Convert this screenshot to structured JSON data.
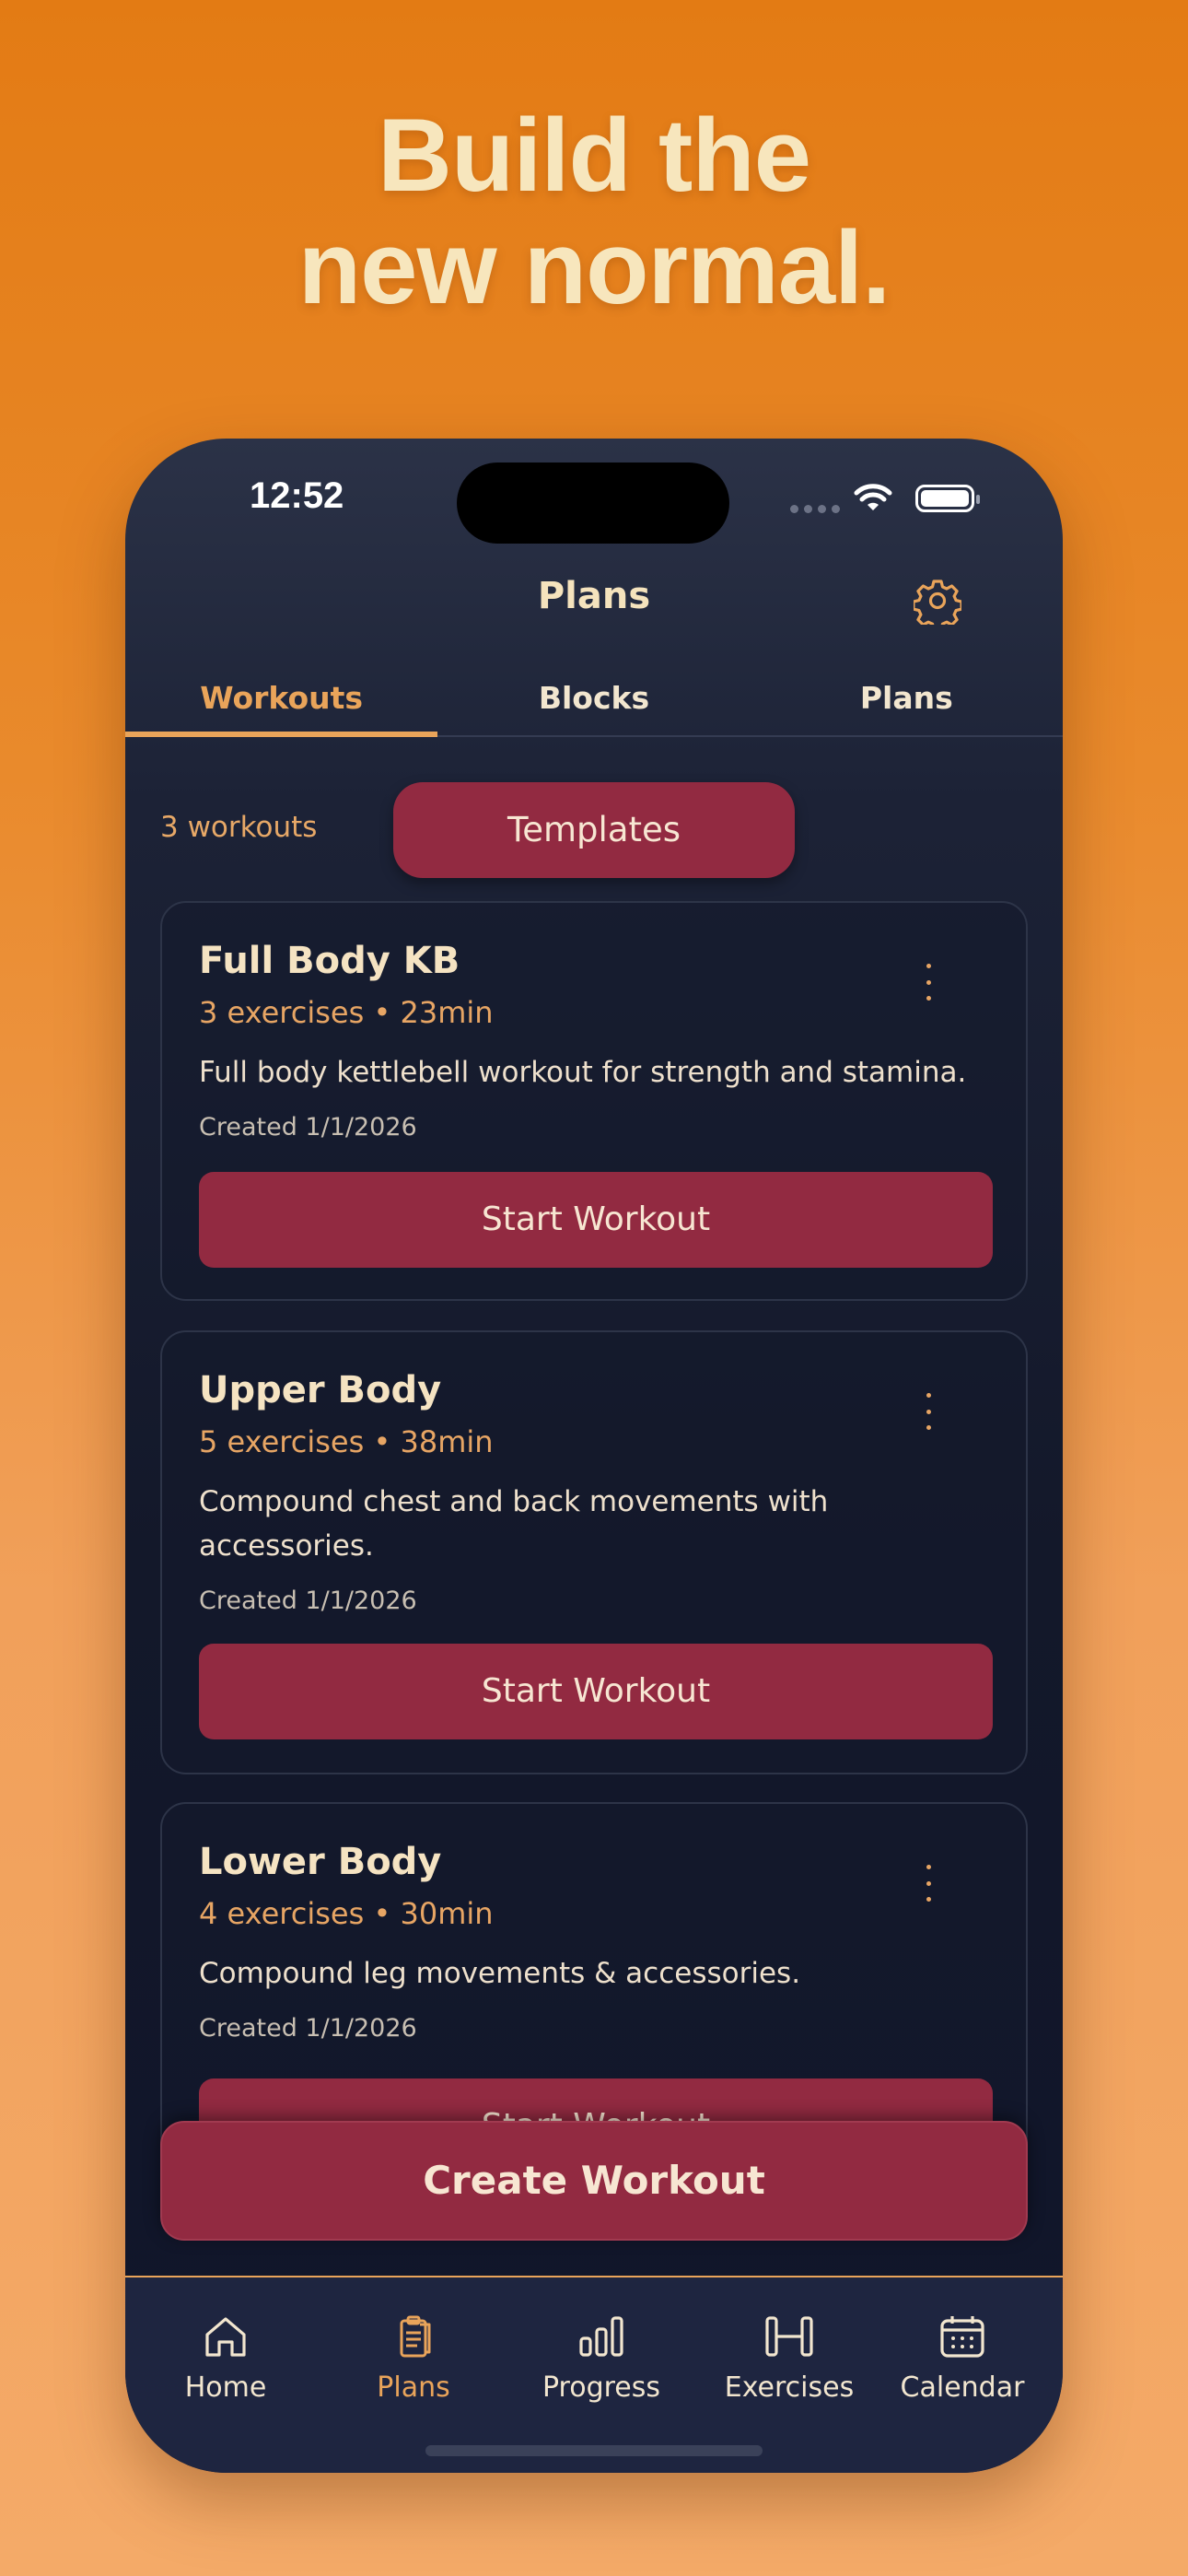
{
  "marketing": {
    "headline_line1": "Build the",
    "headline_line2": "new normal."
  },
  "status_bar": {
    "time": "12:52"
  },
  "nav": {
    "title": "Plans",
    "settings_icon": "gear-icon"
  },
  "tabs": [
    {
      "label": "Workouts",
      "active": true
    },
    {
      "label": "Blocks",
      "active": false
    },
    {
      "label": "Plans",
      "active": false
    }
  ],
  "toolbar": {
    "count_label": "3 workouts",
    "templates_label": "Templates"
  },
  "workouts": [
    {
      "name": "Full Body KB",
      "meta": "3 exercises • 23min",
      "description": "Full body kettlebell workout for strength and stamina.",
      "created": "Created 1/1/2026",
      "action": "Start Workout"
    },
    {
      "name": "Upper Body",
      "meta": "5 exercises • 38min",
      "description": "Compound chest and back movements with accessories.",
      "created": "Created 1/1/2026",
      "action": "Start Workout"
    },
    {
      "name": "Lower Body",
      "meta": "4 exercises • 30min",
      "description": "Compound leg movements & accessories.",
      "created": "Created 1/1/2026",
      "action": "Start Workout"
    }
  ],
  "create_button": "Create Workout",
  "tabbar": [
    {
      "label": "Home",
      "icon": "home-icon",
      "active": false
    },
    {
      "label": "Plans",
      "icon": "clipboard-icon",
      "active": true
    },
    {
      "label": "Progress",
      "icon": "bar-chart-icon",
      "active": false
    },
    {
      "label": "Exercises",
      "icon": "dumbbell-icon",
      "active": false
    },
    {
      "label": "Calendar",
      "icon": "calendar-icon",
      "active": false
    }
  ],
  "colors": {
    "accent": "#e9a45a",
    "button": "#922a41",
    "background": "#e37b14",
    "headline": "#f7e6bd"
  }
}
